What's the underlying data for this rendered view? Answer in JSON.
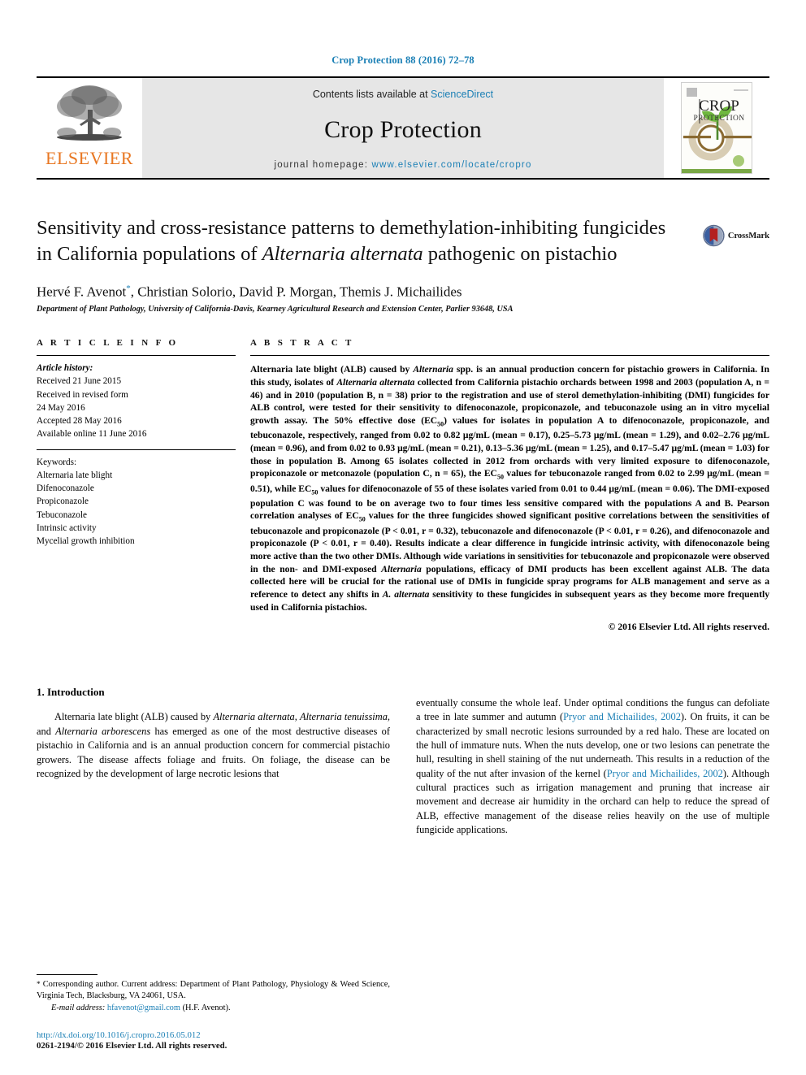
{
  "running_head": "Crop Protection 88 (2016) 72–78",
  "masthead": {
    "elsevier_wordmark": "ELSEVIER",
    "contents_prefix": "Contents lists available at ",
    "contents_link": "ScienceDirect",
    "journal_title": "Crop Protection",
    "homepage_prefix": "journal homepage: ",
    "homepage_url": "www.elsevier.com/locate/cropro",
    "cover_title_line1": "CROP",
    "cover_title_line2": "PROTECTION"
  },
  "article": {
    "title_part1": "Sensitivity and cross-resistance patterns to demethylation-inhibiting fungicides in California populations of ",
    "title_italic": "Alternaria alternata",
    "title_part2": " pathogenic on pistachio",
    "authors": "Hervé F. Avenot",
    "authors_rest": ", Christian Solorio, David P. Morgan, Themis J. Michailides",
    "corresponding_marker": "*",
    "affiliation": "Department of Plant Pathology, University of California-Davis, Kearney Agricultural Research and Extension Center, Parlier 93648, USA",
    "crossmark_label": "CrossMark"
  },
  "article_info": {
    "heading": "A R T I C L E   I N F O",
    "history_label": "Article history:",
    "history": [
      "Received 21 June 2015",
      "Received in revised form",
      "24 May 2016",
      "Accepted 28 May 2016",
      "Available online 11 June 2016"
    ],
    "keywords_label": "Keywords:",
    "keywords": [
      "Alternaria late blight",
      "Difenoconazole",
      "Propiconazole",
      "Tebuconazole",
      "Intrinsic activity",
      "Mycelial growth inhibition"
    ]
  },
  "abstract": {
    "heading": "A B S T R A C T",
    "p1a": "Alternaria late blight (ALB) caused by ",
    "p1b_italic": "Alternaria",
    "p1c": " spp. is an annual production concern for pistachio growers in California. In this study, isolates of ",
    "p1d_italic": "Alternaria alternata",
    "p1e": " collected from California pistachio orchards between 1998 and 2003 (population A, n = 46) and in 2010 (population B, n = 38) prior to the registration and use of sterol demethylation-inhibiting (DMI) fungicides for ALB control, were tested for their sensitivity to difenoconazole, propiconazole, and tebuconazole using an in vitro mycelial growth assay. The 50% effective dose (EC",
    "p1f_sub": "50",
    "p1g": ") values for isolates in population A to difenoconazole, propiconazole, and tebuconazole, respectively, ranged from 0.02 to 0.82 μg/mL (mean = 0.17), 0.25–5.73 μg/mL (mean = 1.29), and 0.02–2.76 μg/mL (mean = 0.96), and from 0.02 to 0.93 μg/mL (mean = 0.21), 0.13–5.36 μg/mL (mean = 1.25), and 0.17–5.47 μg/mL (mean = 1.03) for those in population B. Among 65 isolates collected in 2012 from orchards with very limited exposure to difenoconazole, propiconazole or metconazole (population C, n = 65), the EC",
    "p1h_sub": "50",
    "p1i": " values for tebuconazole ranged from 0.02 to 2.99 μg/mL (mean = 0.51), while EC",
    "p1j_sub": "50",
    "p1k": " values for difenoconazole of 55 of these isolates varied from 0.01 to 0.44 μg/mL (mean = 0.06). The DMI-exposed population C was found to be on average two to four times less sensitive compared with the populations A and B. Pearson correlation analyses of EC",
    "p1l_sub": "50",
    "p1m": " values for the three fungicides showed significant positive correlations between the sensitivities of tebuconazole and propiconazole (P < 0.01, r = 0.32), tebuconazole and difenoconazole (P < 0.01, r = 0.26), and difenoconazole and propiconazole (P < 0.01, r = 0.40). Results indicate a clear difference in fungicide intrinsic activity, with difenoconazole being more active than the two other DMIs. Although wide variations in sensitivities for tebuconazole and propiconazole were observed in the non- and DMI-exposed ",
    "p1n_italic": "Alternaria",
    "p1o": " populations, efficacy of DMI products has been excellent against ALB. The data collected here will be crucial for the rational use of DMIs in fungicide spray programs for ALB management and serve as a reference to detect any shifts in ",
    "p1p_italic": "A. alternata",
    "p1q": " sensitivity to these fungicides in subsequent years as they become more frequently used in California pistachios.",
    "copyright": "© 2016 Elsevier Ltd. All rights reserved."
  },
  "introduction": {
    "section_number_title": "1. Introduction",
    "left_a": "Alternaria late blight (ALB) caused by ",
    "left_a_italic1": "Alternaria alternata",
    "left_b": ", ",
    "left_b_italic": "Alternaria tenuissima",
    "left_c": ", and ",
    "left_c_italic": "Alternaria arborescens",
    "left_d": " has emerged as one of the most destructive diseases of pistachio in California and is an annual production concern for commercial pistachio growers. The disease affects foliage and fruits. On foliage, the disease can be recognized by the development of large necrotic lesions that",
    "right_a": "eventually consume the whole leaf. Under optimal conditions the fungus can defoliate a tree in late summer and autumn (",
    "right_cite1": "Pryor and Michailides, 2002",
    "right_b": "). On fruits, it can be characterized by small necrotic lesions surrounded by a red halo. These are located on the hull of immature nuts. When the nuts develop, one or two lesions can penetrate the hull, resulting in shell staining of the nut underneath. This results in a reduction of the quality of the nut after invasion of the kernel (",
    "right_cite2": "Pryor and Michailides, 2002",
    "right_c": "). Although cultural practices such as irrigation management and pruning that increase air movement and decrease air humidity in the orchard can help to reduce the spread of ALB, effective management of the disease relies heavily on the use of multiple fungicide applications."
  },
  "footnotes": {
    "corresponding_star": "*",
    "corresponding_text": " Corresponding author. Current address: Department of Plant Pathology, Physiology & Weed Science, Virginia Tech, Blacksburg, VA 24061, USA.",
    "email_label": "E-mail address:",
    "email": "hfavenot@gmail.com",
    "email_suffix": " (H.F. Avenot).",
    "doi": "http://dx.doi.org/10.1016/j.cropro.2016.05.012",
    "issn_line": "0261-2194/© 2016 Elsevier Ltd. All rights reserved."
  },
  "colors": {
    "link_blue": "#1a7fb5",
    "elsevier_orange": "#E87722",
    "masthead_gray": "#e6e6e6"
  }
}
